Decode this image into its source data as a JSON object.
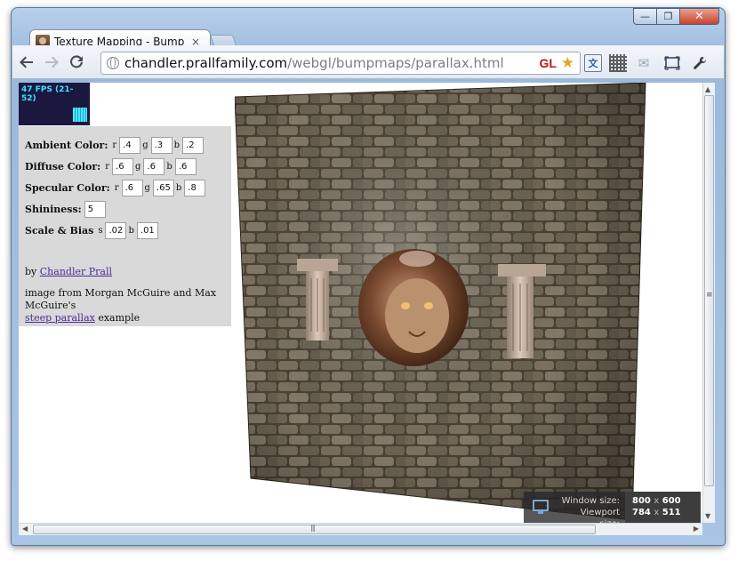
{
  "browser": {
    "tab_title": "Texture Mapping - Bump M",
    "tab_close": "×",
    "url_host": "chandler.prallfamily.com",
    "url_path": "/webgl/bumpmaps/parallax.html",
    "gl_badge": "GL",
    "win_minimize": "—",
    "win_maximize": "❐",
    "win_close": "✕",
    "icons": [
      "back-icon",
      "forward-icon",
      "reload-icon",
      "globe-icon",
      "star-icon",
      "translate-icon",
      "qr-code-icon",
      "mail-icon",
      "screen-icon",
      "wrench-icon"
    ]
  },
  "fps": {
    "text": "47 FPS (21-52)"
  },
  "controls": {
    "ambient": {
      "label": "Ambient Color:",
      "r": ".4",
      "g": ".3",
      "b": ".2"
    },
    "diffuse": {
      "label": "Diffuse Color:",
      "r": ".6",
      "g": ".6",
      "b": ".6"
    },
    "specular": {
      "label": "Specular Color:",
      "r": ".6",
      "g": ".65",
      "b": ".8"
    },
    "shininess": {
      "label": "Shininess:",
      "value": "5"
    },
    "scale_bias": {
      "label": "Scale & Bias",
      "s": ".02",
      "b": ".01"
    },
    "channel_r": "r",
    "channel_g": "g",
    "channel_b": "b",
    "channel_s": "s"
  },
  "credits": {
    "by": "by",
    "author": "Chandler Prall",
    "image_from": "image from Morgan McGuire and Max McGuire's",
    "parallax_link": "steep parallax",
    "example": "example"
  },
  "size_overlay": {
    "window_label": "Window size:",
    "viewport_label": "Viewport size:",
    "window_w": "800",
    "window_h": "600",
    "viewport_w": "784",
    "viewport_h": "511",
    "times": "x"
  },
  "colors": {
    "accent_link": "#4a2a9a",
    "fps_bg": "#1b1840",
    "fps_text": "#3fe0ff",
    "panel_bg": "#d9d9d9"
  }
}
